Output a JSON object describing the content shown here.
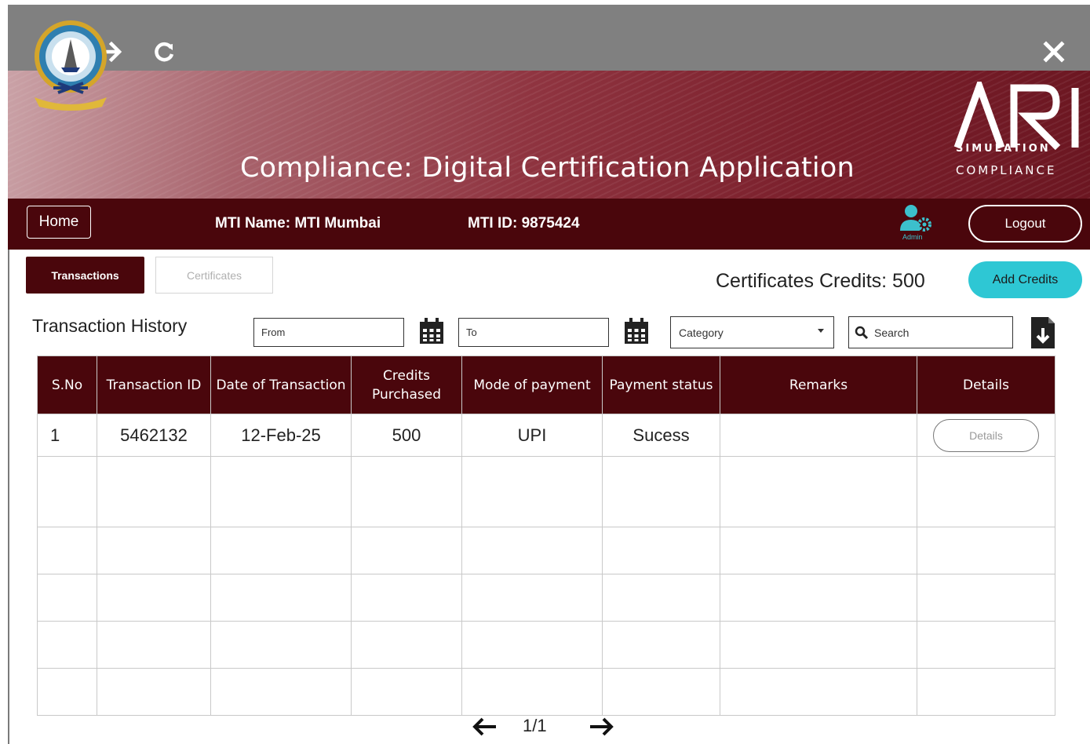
{
  "browser": {
    "back_icon": "arrow-left-icon",
    "forward_icon": "arrow-right-icon",
    "reload_icon": "reload-icon",
    "close_icon": "close-icon"
  },
  "header": {
    "title": "Compliance: Digital Certification Application",
    "logo_text": "ARI",
    "logo_line1": "SIMULATION",
    "logo_line2": "COMPLIANCE"
  },
  "topbar": {
    "home_label": "Home",
    "mti_name": "MTI Name: MTI Mumbai",
    "mti_id": "MTI ID: 9875424",
    "admin_label": "Admin",
    "logout_label": "Logout"
  },
  "tabs": [
    {
      "label": "Transactions",
      "active": true
    },
    {
      "label": "Certificates",
      "active": false
    }
  ],
  "credits": {
    "text": "Certificates Credits: 500",
    "add_label": "Add Credits"
  },
  "filters": {
    "section_title": "Transaction History",
    "from_placeholder": "From",
    "to_placeholder": "To",
    "category_label": "Category",
    "search_placeholder": "Search"
  },
  "table": {
    "headers": [
      "S.No",
      "Transaction ID",
      "Date of Transaction",
      "Credits Purchased",
      "Mode of payment",
      "Payment status",
      "Remarks",
      "Details"
    ],
    "rows": [
      {
        "sno": "1",
        "txn_id": "5462132",
        "date": "12-Feb-25",
        "credits": "500",
        "mode": "UPI",
        "status": "Sucess",
        "remarks": "",
        "details_label": "Details"
      }
    ]
  },
  "pagination": {
    "text": "1/1"
  },
  "colors": {
    "primary": "#4a060c",
    "accent": "#2ec7d4",
    "chrome": "#808080"
  }
}
